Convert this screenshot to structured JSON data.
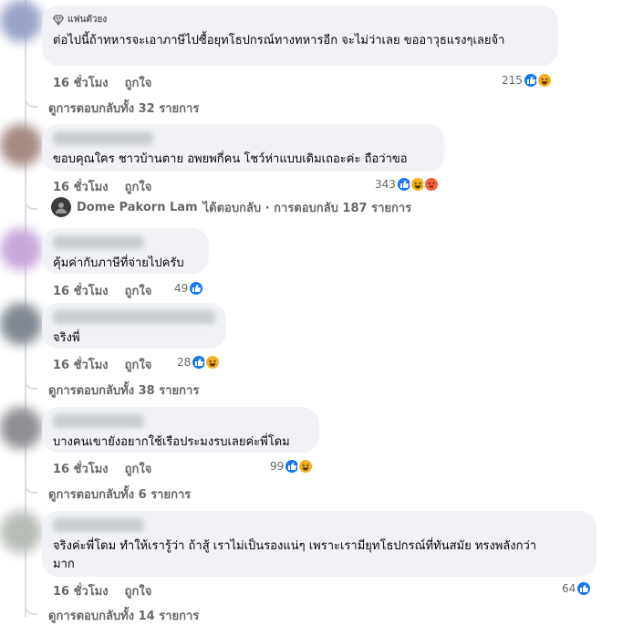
{
  "comments": [
    {
      "badge": "แฟนตัวยง",
      "text": "ต่อไปนี้ถ้าทหารจะเอาภาษีไปซื้อยุทโธปกรณ์ทางทหารอีก จะไม่ว่าเลย ขออาวุธแรงๆเลยจ้า",
      "time": "16 ชั่วโมง",
      "like_label": "ถูกใจ",
      "reaction_count": "215",
      "reactions": [
        "like",
        "haha"
      ]
    },
    {
      "text": "ขอบคุณใคร ชาวบ้านตาย อพยพกี่คน โชว์ห่าแบบเดิมเถอะค่ะ ถือว่าขอ",
      "time": "16 ชั่วโมง",
      "like_label": "ถูกใจ",
      "reaction_count": "343",
      "reactions": [
        "like",
        "haha",
        "angry"
      ]
    },
    {
      "text": "คุ้มค่ากับภาษีที่จ่ายไปครับ",
      "time": "16 ชั่วโมง",
      "like_label": "ถูกใจ",
      "reaction_count": "49",
      "reactions": [
        "like"
      ]
    },
    {
      "text": "จริงพี่",
      "time": "16 ชั่วโมง",
      "like_label": "ถูกใจ",
      "reaction_count": "28",
      "reactions": [
        "like",
        "haha"
      ]
    },
    {
      "text": "บางคนเขายังอยากใช้เรือประมงรบเลยค่ะพี่โดม",
      "time": "16 ชั่วโมง",
      "like_label": "ถูกใจ",
      "reaction_count": "99",
      "reactions": [
        "like",
        "haha"
      ]
    },
    {
      "text": "จริงค่ะพี่โดม ทำให้เรารู้ว่า ถ้าสู้ เราไม่เป็นรองแน่ๆ เพราะเรามียุทโธปกรณ์ที่ทันสมัย ทรงพลังกว่า\nมาก",
      "time": "16 ชั่วโมง",
      "like_label": "ถูกใจ",
      "reaction_count": "64",
      "reactions": [
        "like"
      ]
    }
  ],
  "view_replies": [
    "ดูการตอบกลับทั้ง 32 รายการ",
    "ดูการตอบกลับทั้ง 38 รายการ",
    "ดูการตอบกลับทั้ง 6 รายการ",
    "ดูการตอบกลับทั้ง 14 รายการ"
  ],
  "reply_summary": {
    "author": "Dome Pakorn Lam",
    "text": "ได้ตอบกลับ · การตอบกลับ 187 รายการ"
  },
  "colors": {
    "like": "#1877f2",
    "haha": "#f7b125",
    "angry": "#f0613c",
    "bubble": "#f0f2f5",
    "meta": "#65676b"
  }
}
